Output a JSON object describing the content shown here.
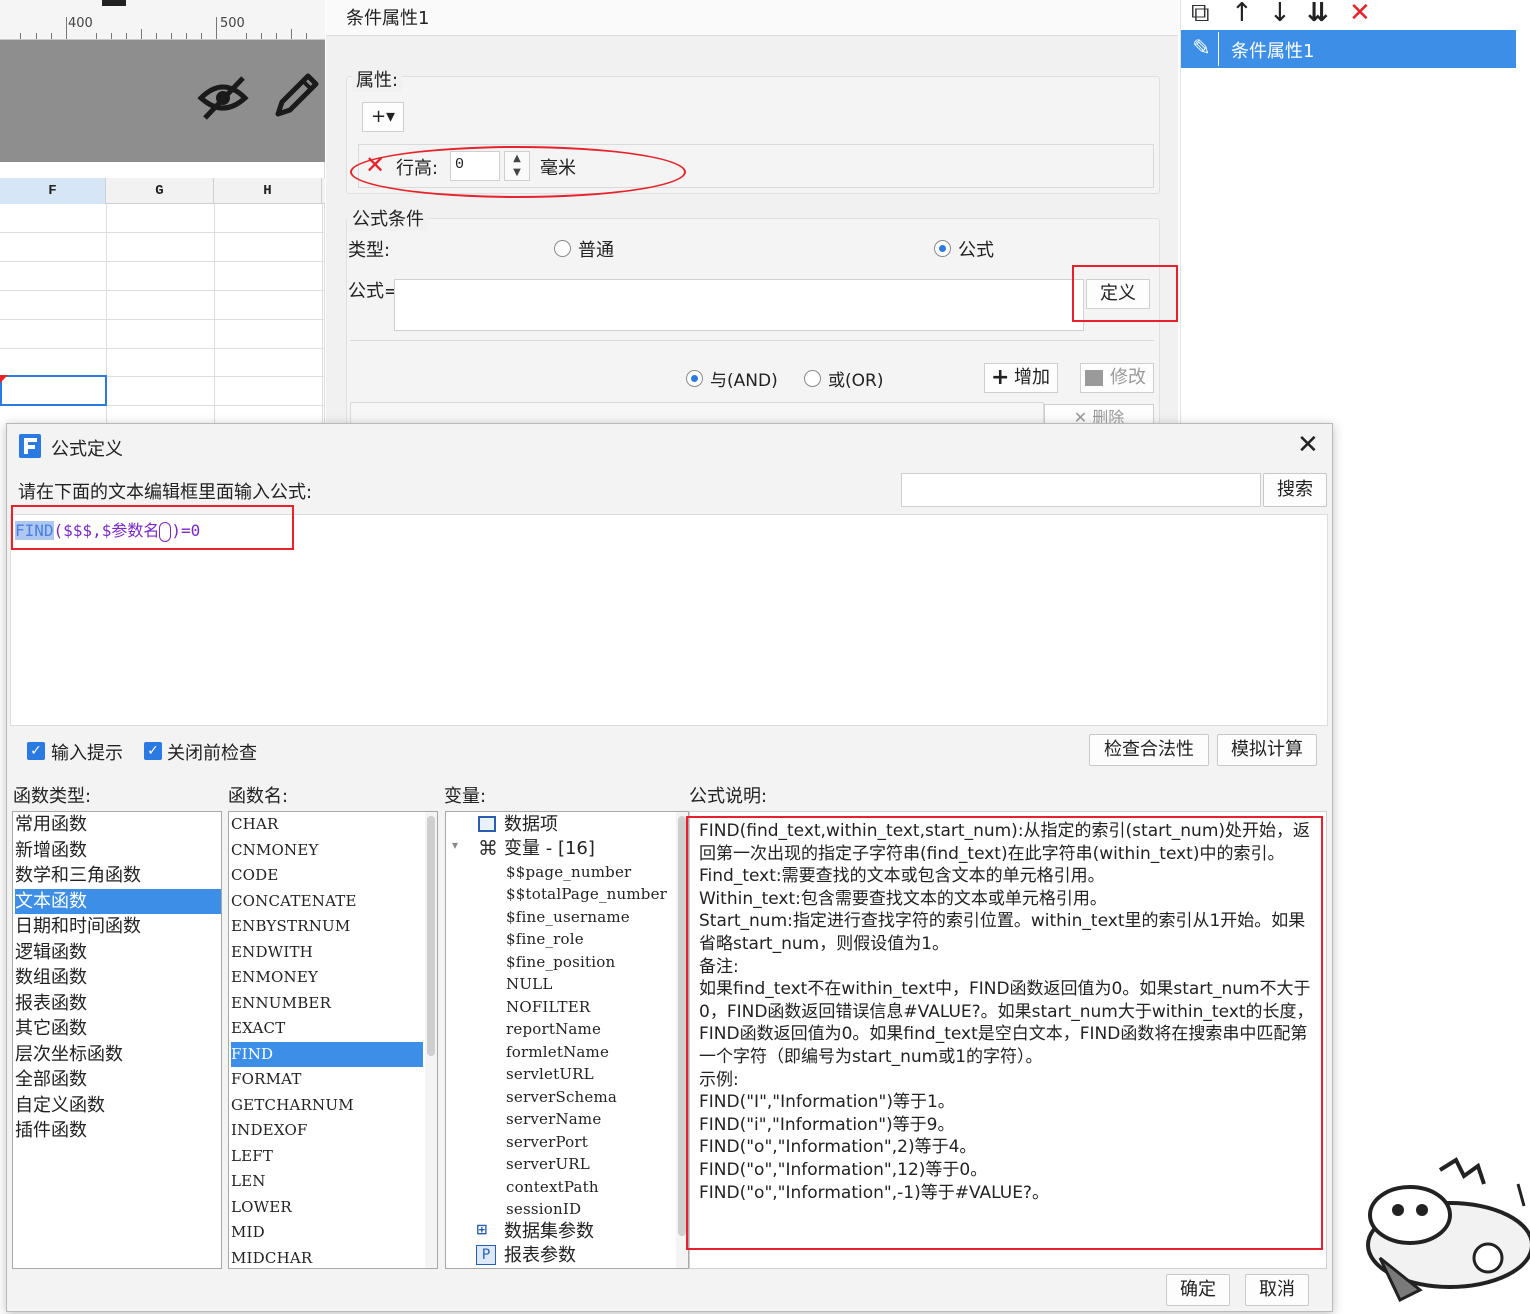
{
  "sheet": {
    "ruler": [
      "400",
      "500"
    ],
    "columns": [
      "F",
      "G",
      "H"
    ]
  },
  "condition_panel": {
    "title": "条件属性1",
    "attributes_label": "属性:",
    "add_button": "+▾",
    "row_height_label": "行高:",
    "row_height_value": "0",
    "unit": "毫米",
    "formula_condition_label": "公式条件",
    "type_label": "类型:",
    "type_normal": "普通",
    "type_formula": "公式",
    "formula_label": "公式=",
    "define_button": "定义",
    "and_label": "与(AND)",
    "or_label": "或(OR)",
    "add_cond_button": "增加",
    "modify_button": "修改",
    "delete_button": "删除"
  },
  "right_list": {
    "selected_item": "条件属性1"
  },
  "dialog": {
    "title": "公式定义",
    "prompt": "请在下面的文本编辑框里面输入公式:",
    "search_button": "搜索",
    "formula_fn": "FIND",
    "formula_rest_a": "($$$,$参数名",
    "formula_rest_b": ")=0",
    "input_hint": "输入提示",
    "check_before_close": "关闭前检查",
    "check_validity_button": "检查合法性",
    "simulate_button": "模拟计算",
    "function_types_label": "函数类型:",
    "function_names_label": "函数名:",
    "variables_label": "变量:",
    "description_label": "公式说明:",
    "function_types": [
      "常用函数",
      "新增函数",
      "数学和三角函数",
      "文本函数",
      "日期和时间函数",
      "逻辑函数",
      "数组函数",
      "报表函数",
      "其它函数",
      "层次坐标函数",
      "全部函数",
      "自定义函数",
      "插件函数"
    ],
    "selected_type": "文本函数",
    "function_names": [
      "CHAR",
      "CNMONEY",
      "CODE",
      "CONCATENATE",
      "ENBYSTRNUM",
      "ENDWITH",
      "ENMONEY",
      "ENNUMBER",
      "EXACT",
      "FIND",
      "FORMAT",
      "GETCHARNUM",
      "INDEXOF",
      "LEFT",
      "LEN",
      "LOWER",
      "MID",
      "MIDCHAR"
    ],
    "selected_function": "FIND",
    "variables_root": "数据项",
    "variables_group": "变量 - [16]",
    "variables": [
      "$$page_number",
      "$$totalPage_number",
      "$fine_username",
      "$fine_role",
      "$fine_position",
      "NULL",
      "NOFILTER",
      "reportName",
      "formletName",
      "servletURL",
      "serverSchema",
      "serverName",
      "serverPort",
      "serverURL",
      "contextPath",
      "sessionID"
    ],
    "dataset_params": "数据集参数",
    "report_params": "报表参数",
    "description": "FIND(find_text,within_text,start_num):从指定的索引(start_num)处开始，返回第一次出现的指定子字符串(find_text)在此字符串(within_text)中的索引。\nFind_text:需要查找的文本或包含文本的单元格引用。\nWithin_text:包含需要查找文本的文本或单元格引用。\nStart_num:指定进行查找字符的索引位置。within_text里的索引从1开始。如果省略start_num，则假设值为1。\n备注:\n如果find_text不在within_text中，FIND函数返回值为0。如果start_num不大于0，FIND函数返回错误信息#VALUE?。如果start_num大于within_text的长度，FIND函数返回值为0。如果find_text是空白文本，FIND函数将在搜索串中匹配第一个字符（即编号为start_num或1的字符）。\n示例:\nFIND(\"I\",\"Information\")等于1。\nFIND(\"i\",\"Information\")等于9。\nFIND(\"o\",\"Information\",2)等于4。\nFIND(\"o\",\"Information\",12)等于0。\nFIND(\"o\",\"Information\",-1)等于#VALUE?。",
    "ok_button": "确定",
    "cancel_button": "取消"
  },
  "colors": {
    "accent": "#3d8ee6",
    "highlight_red": "#e8222a",
    "formula_purple": "#7a28c6"
  }
}
